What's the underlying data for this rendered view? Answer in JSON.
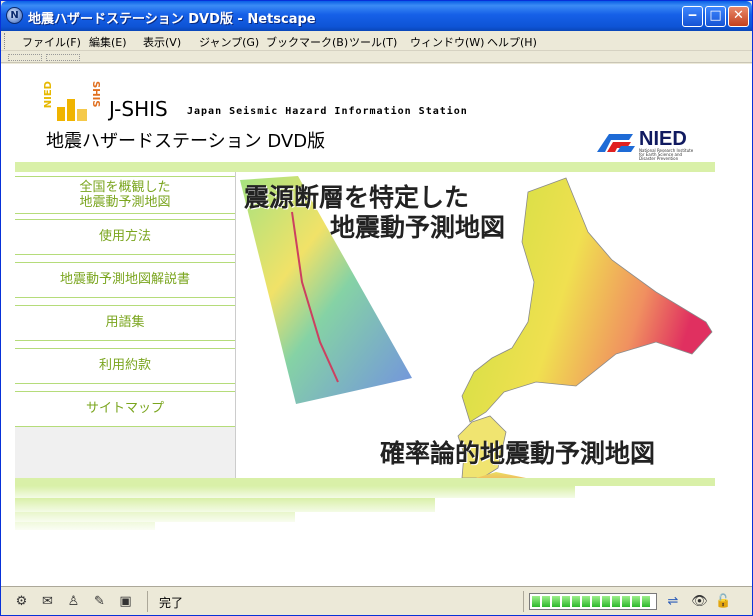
{
  "window": {
    "title": "地震ハザードステーション DVD版 - Netscape",
    "app_icon": "N",
    "minimize_glyph": "‒",
    "maximize_glyph": "□",
    "close_glyph": "✕"
  },
  "menubar": {
    "items": [
      "ファイル(F)",
      "編集(E)",
      "表示(V)",
      "ジャンプ(G)",
      "ブックマーク(B)",
      "ツール(T)",
      "ウィンドウ(W)",
      "ヘルプ(H)"
    ]
  },
  "header": {
    "logo_nied": "NIED",
    "logo_shis": "SHIS",
    "brand": "J-SHIS",
    "brand_sub": "Japan Seismic Hazard Information Station",
    "page_title": "地震ハザードステーション DVD版",
    "nied_logo": "NIED",
    "nied_logo_caption": "National Research Institute for Earth Science and Disaster Prevention"
  },
  "nav": {
    "items": [
      {
        "label_line1": "全国を概観した",
        "label_line2": "地震動予測地図"
      },
      {
        "label_line1": "使用方法"
      },
      {
        "label_line1": "地震動予測地図解説書"
      },
      {
        "label_line1": "用語集"
      },
      {
        "label_line1": "利用約款"
      },
      {
        "label_line1": "サイトマップ"
      }
    ]
  },
  "hero": {
    "line1": "震源断層を特定した",
    "line2": "地震動予測地図",
    "line3": "確率論的地震動予測地図"
  },
  "statusbar": {
    "status_text": "完了",
    "icons": [
      "navigator-icon",
      "mail-icon",
      "composer-icon",
      "edit-icon",
      "addressbook-icon"
    ]
  },
  "colors": {
    "accent_green": "#7aa51e",
    "light_green": "#d9f0a8",
    "title_blue": "#0a5fe6"
  }
}
